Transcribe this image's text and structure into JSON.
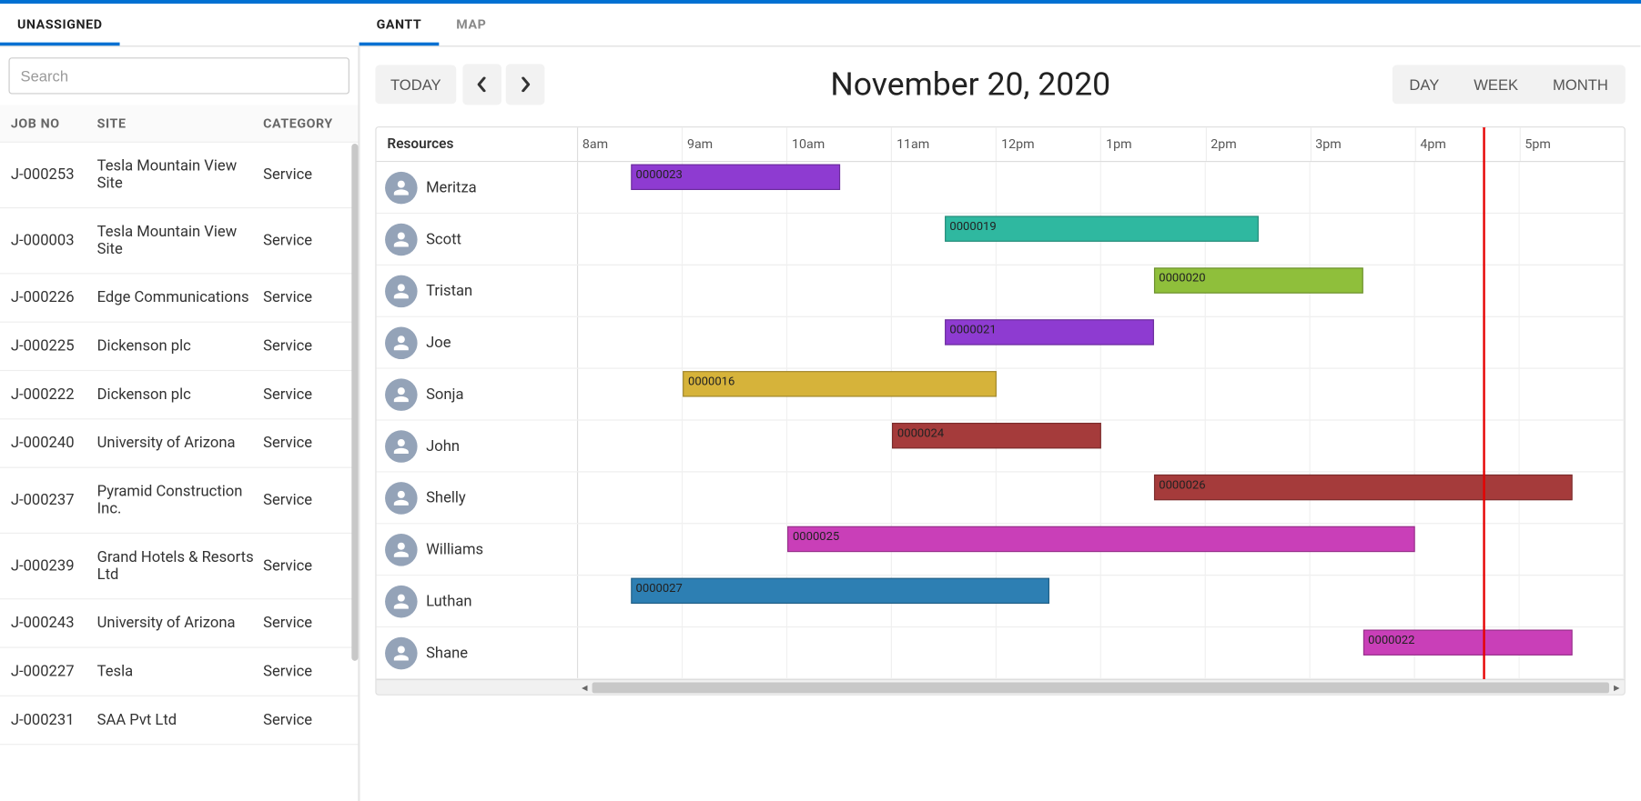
{
  "tabs_left": [
    {
      "label": "UNASSIGNED",
      "active": true
    }
  ],
  "tabs_right": [
    {
      "label": "GANTT",
      "active": true
    },
    {
      "label": "MAP",
      "active": false
    }
  ],
  "search": {
    "placeholder": "Search"
  },
  "list_headers": {
    "job": "JOB NO",
    "site": "SITE",
    "category": "CATEGORY"
  },
  "jobs": [
    {
      "no": "J-000253",
      "site": "Tesla Mountain View Site",
      "cat": "Service"
    },
    {
      "no": "J-000003",
      "site": "Tesla Mountain View Site",
      "cat": "Service"
    },
    {
      "no": "J-000226",
      "site": "Edge Communications",
      "cat": "Service"
    },
    {
      "no": "J-000225",
      "site": "Dickenson plc",
      "cat": "Service"
    },
    {
      "no": "J-000222",
      "site": "Dickenson plc",
      "cat": "Service"
    },
    {
      "no": "J-000240",
      "site": "University of Arizona",
      "cat": "Service"
    },
    {
      "no": "J-000237",
      "site": "Pyramid Construction Inc.",
      "cat": "Service"
    },
    {
      "no": "J-000239",
      "site": "Grand Hotels & Resorts Ltd",
      "cat": "Service"
    },
    {
      "no": "J-000243",
      "site": "University of Arizona",
      "cat": "Service"
    },
    {
      "no": "J-000227",
      "site": "Tesla",
      "cat": "Service"
    },
    {
      "no": "J-000231",
      "site": "SAA Pvt Ltd",
      "cat": "Service"
    }
  ],
  "toolbar": {
    "today": "TODAY",
    "date_title": "November 20, 2020",
    "views": {
      "day": "DAY",
      "week": "WEEK",
      "month": "MONTH"
    }
  },
  "gantt": {
    "resources_header": "Resources",
    "hours": [
      "8am",
      "9am",
      "10am",
      "11am",
      "12pm",
      "1pm",
      "2pm",
      "3pm",
      "4pm",
      "5pm"
    ],
    "now_hour": 16.65,
    "rows": [
      {
        "name": "Meritza",
        "bars": [
          {
            "id": "0000023",
            "start": 8.5,
            "end": 10.5,
            "color": "#8e3bd1"
          }
        ]
      },
      {
        "name": "Scott",
        "bars": [
          {
            "id": "0000019",
            "start": 11.5,
            "end": 14.5,
            "color": "#2fb8a0"
          }
        ]
      },
      {
        "name": "Tristan",
        "bars": [
          {
            "id": "0000020",
            "start": 13.5,
            "end": 15.5,
            "color": "#8fbf3b"
          }
        ]
      },
      {
        "name": "Joe",
        "bars": [
          {
            "id": "0000021",
            "start": 11.5,
            "end": 13.5,
            "color": "#8e3bd1"
          }
        ]
      },
      {
        "name": "Sonja",
        "bars": [
          {
            "id": "0000016",
            "start": 9.0,
            "end": 12.0,
            "color": "#d6b33a"
          }
        ]
      },
      {
        "name": "John",
        "bars": [
          {
            "id": "0000024",
            "start": 11.0,
            "end": 13.0,
            "color": "#a53b3b"
          }
        ]
      },
      {
        "name": "Shelly",
        "bars": [
          {
            "id": "0000026",
            "start": 13.5,
            "end": 17.5,
            "color": "#a53b3b"
          }
        ]
      },
      {
        "name": "Williams",
        "bars": [
          {
            "id": "0000025",
            "start": 10.0,
            "end": 16.0,
            "color": "#c93fb8"
          }
        ]
      },
      {
        "name": "Luthan",
        "bars": [
          {
            "id": "0000027",
            "start": 8.5,
            "end": 12.5,
            "color": "#2d7fb3"
          }
        ]
      },
      {
        "name": "Shane",
        "bars": [
          {
            "id": "0000022",
            "start": 15.5,
            "end": 17.5,
            "color": "#c93fb8"
          }
        ]
      }
    ]
  }
}
